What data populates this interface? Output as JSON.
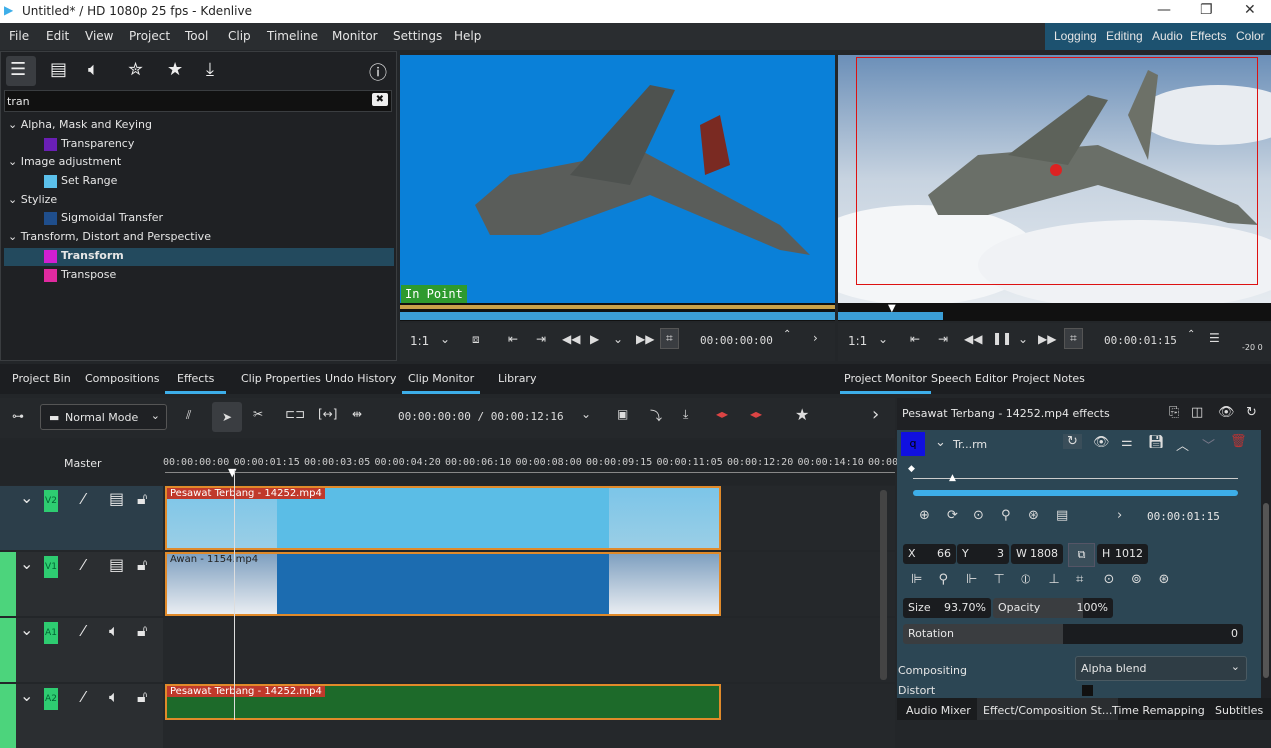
{
  "window": {
    "title": "Untitled* / HD 1080p 25 fps - Kdenlive",
    "minimize": "—",
    "maximize": "❐",
    "close": "✕"
  },
  "menu": [
    "File",
    "Edit",
    "View",
    "Project",
    "Tool",
    "Clip",
    "Timeline",
    "Monitor",
    "Settings",
    "Help"
  ],
  "layouts": [
    "Logging",
    "Editing",
    "Audio",
    "Effects",
    "Color"
  ],
  "effects_panel": {
    "search_value": "tran",
    "tree": [
      {
        "label": "Alpha, Mask and Keying",
        "type": "group"
      },
      {
        "label": "Transparency",
        "type": "item",
        "color": "#6a1fb5"
      },
      {
        "label": "Image adjustment",
        "type": "group"
      },
      {
        "label": "Set Range",
        "type": "item",
        "color": "#5bc0eb"
      },
      {
        "label": "Stylize",
        "type": "group"
      },
      {
        "label": "Sigmoidal Transfer",
        "type": "item",
        "color": "#1f4e8c"
      },
      {
        "label": "Transform, Distort and Perspective",
        "type": "group"
      },
      {
        "label": "Transform",
        "type": "item",
        "color": "#d21fd2",
        "selected": true
      },
      {
        "label": "Transpose",
        "type": "item",
        "color": "#e02aa0"
      }
    ]
  },
  "clip_monitor": {
    "overlay": "In Point",
    "zoom": "1:1",
    "timecode": "00:00:00:00"
  },
  "project_monitor": {
    "zoom": "1:1",
    "timecode": "00:00:01:15",
    "meter": "-20 0"
  },
  "left_tabs": [
    "Project Bin",
    "Compositions",
    "Effects",
    "Clip Properties",
    "Undo History"
  ],
  "clip_tabs": [
    "Clip Monitor",
    "Library"
  ],
  "project_tabs": [
    "Project Monitor",
    "Speech Editor",
    "Project Notes"
  ],
  "timeline": {
    "mode": "Normal Mode",
    "timecode": "00:00:00:00 / 00:00:12:16",
    "master": "Master",
    "ruler": [
      "00:00:00:00",
      "00:00:01:15",
      "00:00:03:05",
      "00:00:04:20",
      "00:00:06:10",
      "00:00:08:00",
      "00:00:09:15",
      "00:00:11:05",
      "00:00:12:20",
      "00:00:14:10",
      "00:00"
    ],
    "tracks": [
      {
        "name": "V2",
        "clip": "Pesawat Terbang - 14252.mp4"
      },
      {
        "name": "V1",
        "clip": "Awan - 1154.mp4"
      },
      {
        "name": "A1",
        "clip": ""
      },
      {
        "name": "A2",
        "clip": "Pesawat Terbang - 14252.mp4"
      }
    ]
  },
  "effect_stack": {
    "title": "Pesawat Terbang - 14252.mp4 effects",
    "effect_name": "Tr...rm",
    "badge": "q",
    "timecode": "00:00:01:15",
    "x_label": "X",
    "x": "66",
    "y_label": "Y",
    "y": "3",
    "w_label": "W",
    "w": "1808",
    "h_label": "H",
    "h": "1012",
    "size_label": "Size",
    "size": "93.70%",
    "opacity_label": "Opacity",
    "opacity": "100%",
    "rotation_label": "Rotation",
    "rotation": "0",
    "compositing_label": "Compositing",
    "compositing": "Alpha blend",
    "distort_label": "Distort"
  },
  "bottom_tabs": [
    "Audio Mixer",
    "Effect/Composition St...",
    "Time Remapping",
    "Subtitles"
  ]
}
